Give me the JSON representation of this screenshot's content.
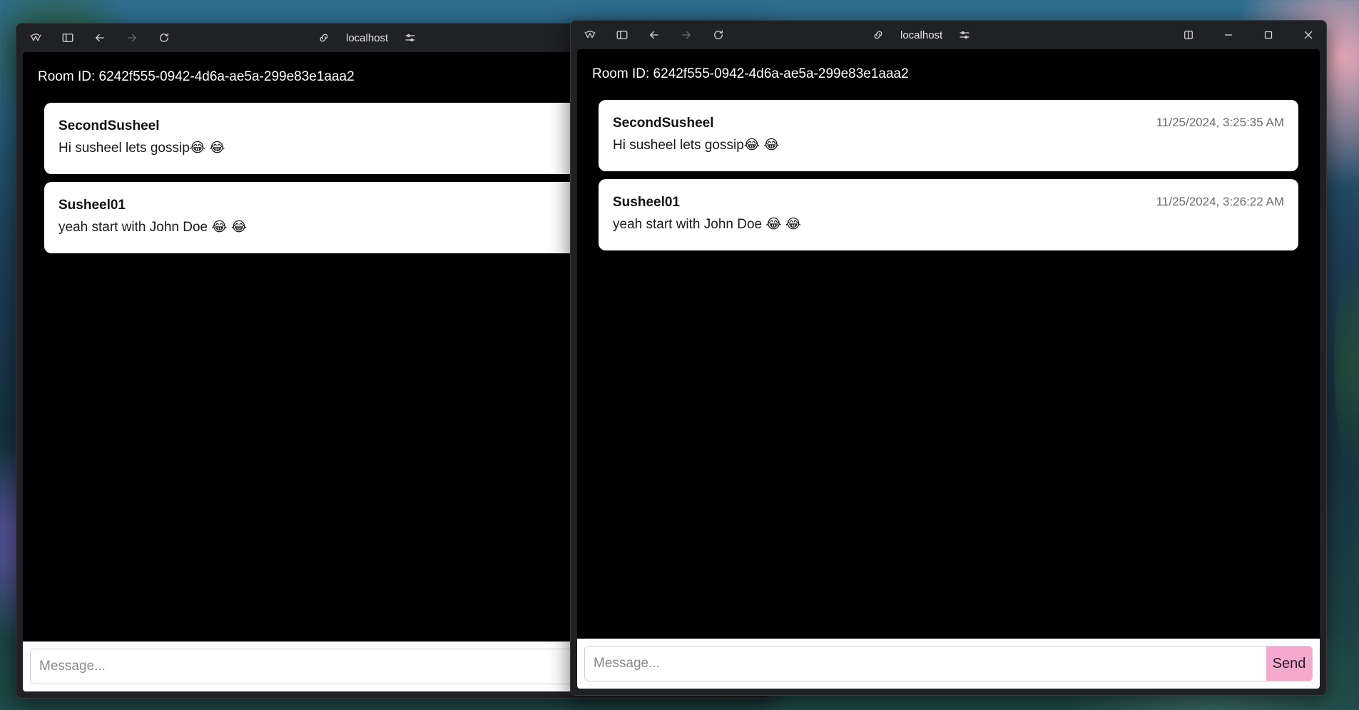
{
  "windows": [
    {
      "address": "localhost",
      "room_id_text": "Room ID: 6242f555-0942-4d6a-ae5a-299e83e1aaa2",
      "messages": [
        {
          "user": "SecondSusheel",
          "text": "Hi susheel lets gossip😂 😂",
          "time": ""
        },
        {
          "user": "Susheel01",
          "text": "yeah start with John Doe 😂 😂",
          "time": ""
        }
      ],
      "composer": {
        "placeholder": "Message...",
        "value": ""
      }
    },
    {
      "address": "localhost",
      "room_id_text": "Room ID: 6242f555-0942-4d6a-ae5a-299e83e1aaa2",
      "messages": [
        {
          "user": "SecondSusheel",
          "text": "Hi susheel lets gossip😂 😂",
          "time": "11/25/2024, 3:25:35 AM"
        },
        {
          "user": "Susheel01",
          "text": "yeah start with John Doe 😂 😂",
          "time": "11/25/2024, 3:26:22 AM"
        }
      ],
      "composer": {
        "placeholder": "Message...",
        "value": "",
        "send_label": "Send"
      }
    }
  ],
  "icons": {
    "app": "browser-logo-icon",
    "sidebar": "sidebar-toggle-icon",
    "back": "arrow-left-icon",
    "forward": "arrow-right-icon",
    "reload": "reload-icon",
    "link": "link-icon",
    "settings": "sliders-icon",
    "split": "split-view-icon",
    "minimize": "minimize-icon",
    "maximize": "maximize-icon",
    "close": "close-icon"
  },
  "colors": {
    "send_button": "#f6a8cf",
    "chat_background": "#000000",
    "bubble": "#ffffff",
    "titlebar": "#202124"
  }
}
